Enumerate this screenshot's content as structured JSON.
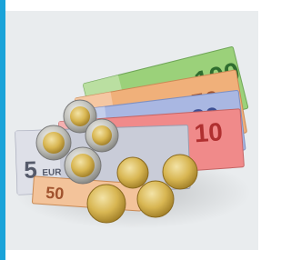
{
  "image": {
    "subject": "euro-banknotes-and-coins-photo",
    "colors": {
      "accent_bar": "#1aa3d9",
      "backdrop": "#e9ecee",
      "note_100": "#9bd17a",
      "note_50": "#f0b07a",
      "note_20": "#a9b7e2",
      "note_10": "#f08a8a",
      "note_5": "#c9ccd8",
      "coin_gold": "#d9b955",
      "coin_silver": "#c9c9c4"
    }
  },
  "notes": {
    "n100": "100",
    "n50": "50",
    "n20": "20",
    "n10": "10",
    "n5": "5",
    "n5_code": "EUR",
    "n50_bottom": "50"
  }
}
